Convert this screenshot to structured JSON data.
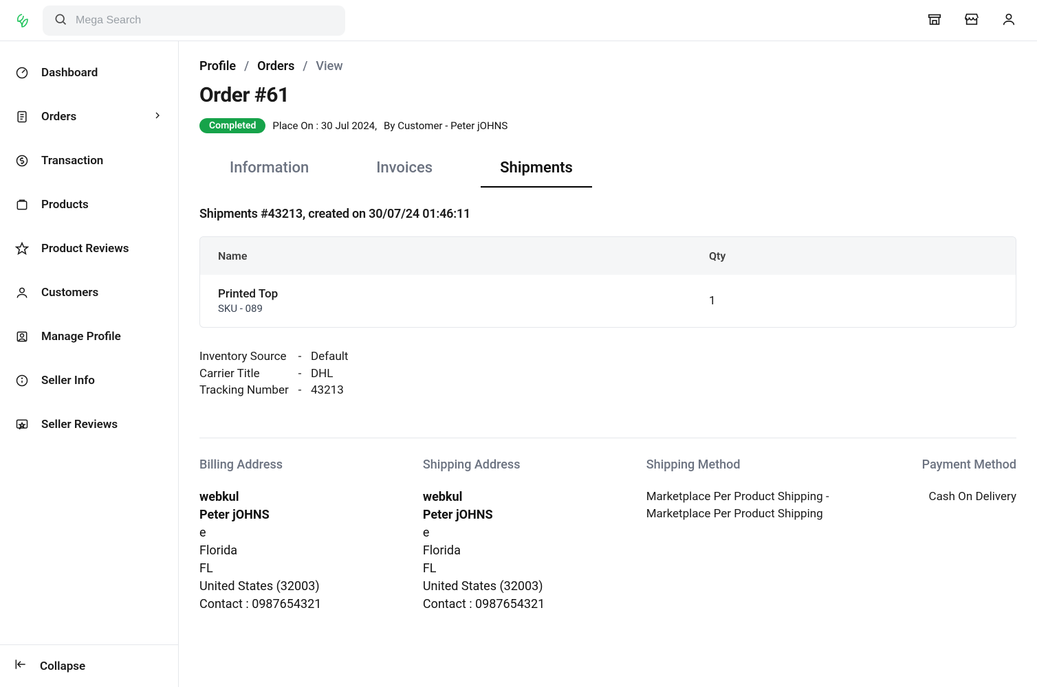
{
  "search": {
    "placeholder": "Mega Search"
  },
  "sidebar": {
    "items": [
      {
        "label": "Dashboard"
      },
      {
        "label": "Orders"
      },
      {
        "label": "Transaction"
      },
      {
        "label": "Products"
      },
      {
        "label": "Product Reviews"
      },
      {
        "label": "Customers"
      },
      {
        "label": "Manage Profile"
      },
      {
        "label": "Seller Info"
      },
      {
        "label": "Seller Reviews"
      }
    ],
    "collapse_label": "Collapse"
  },
  "breadcrumb": {
    "profile": "Profile",
    "orders": "Orders",
    "view": "View",
    "sep": "/"
  },
  "page_title": "Order #61",
  "status_badge": "Completed",
  "meta": {
    "place_on": "Place On : 30 Jul 2024,",
    "by_customer": "By Customer - Peter jOHNS"
  },
  "tabs": {
    "information": "Information",
    "invoices": "Invoices",
    "shipments": "Shipments"
  },
  "shipment": {
    "heading": "Shipments #43213, created on 30/07/24 01:46:11",
    "col_name": "Name",
    "col_qty": "Qty",
    "item": {
      "name": "Printed Top",
      "sku": "SKU - 089",
      "qty": "1"
    },
    "inventory_source_label": "Inventory Source",
    "carrier_title_label": "Carrier Title",
    "tracking_number_label": "Tracking Number",
    "inventory_source": "Default",
    "carrier_title": "DHL",
    "tracking_number": "43213",
    "dash": "-"
  },
  "footer": {
    "billing_heading": "Billing Address",
    "shipping_heading": "Shipping Address",
    "ship_method_heading": "Shipping Method",
    "pay_method_heading": "Payment Method",
    "addr": {
      "company": "webkul",
      "name": "Peter jOHNS",
      "line1": "e",
      "city": "Florida",
      "state": "FL",
      "country": "United States (32003)",
      "contact": "Contact : 0987654321"
    },
    "ship_method_value": "Marketplace Per Product Shipping - Marketplace Per Product Shipping",
    "pay_method_value": "Cash On Delivery"
  }
}
